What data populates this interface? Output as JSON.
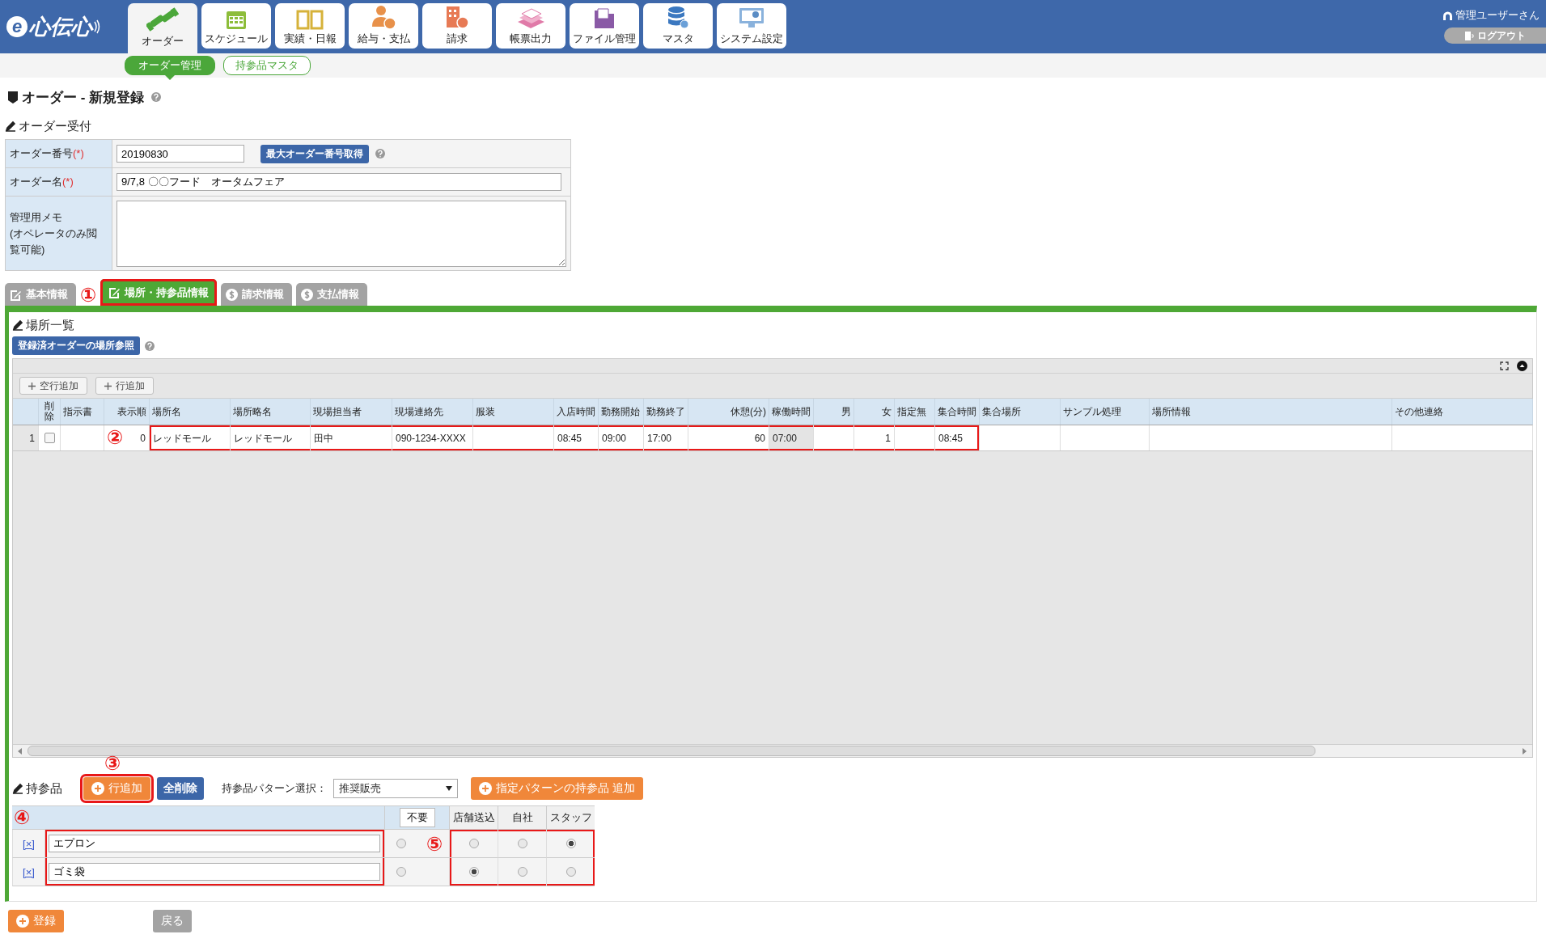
{
  "header": {
    "logo_mark": "e",
    "logo_text": "心伝心",
    "nav": [
      {
        "label": "オーダー",
        "selected": true
      },
      {
        "label": "スケジュール",
        "selected": false
      },
      {
        "label": "実績・日報",
        "selected": false
      },
      {
        "label": "給与・支払",
        "selected": false
      },
      {
        "label": "請求",
        "selected": false
      },
      {
        "label": "帳票出力",
        "selected": false
      },
      {
        "label": "ファイル管理",
        "selected": false
      },
      {
        "label": "マスタ",
        "selected": false
      },
      {
        "label": "システム設定",
        "selected": false
      }
    ],
    "user": "管理ユーザーさん",
    "logout": "ログアウト"
  },
  "subnav": [
    {
      "label": "オーダー管理",
      "selected": true
    },
    {
      "label": "持参品マスタ",
      "selected": false
    }
  ],
  "page_title": "オーダー - 新規登録",
  "reception": {
    "heading": "オーダー受付",
    "fields": [
      {
        "kind": "text",
        "label": "オーダー番号",
        "required": "(*)",
        "value": "20190830",
        "button": "最大オーダー番号取得"
      },
      {
        "kind": "wide",
        "label": "オーダー名",
        "required": "(*)",
        "value": "9/7,8 〇〇フード　オータムフェア"
      },
      {
        "kind": "textarea",
        "label": "管理用メモ",
        "note": "(オペレータのみ閲覧可能)"
      }
    ]
  },
  "tabs": [
    {
      "label": "基本情報",
      "selected": false,
      "highlighted": false
    },
    {
      "label": "場所・持参品情報",
      "selected": true,
      "highlighted": true,
      "callout": "①"
    },
    {
      "label": "請求情報",
      "selected": false,
      "highlighted": false
    },
    {
      "label": "支払情報",
      "selected": false,
      "highlighted": false
    }
  ],
  "places": {
    "heading": "場所一覧",
    "ref_button": "登録済オーダーの場所参照",
    "toolbar_buttons": [
      "空行追加",
      "行追加"
    ],
    "columns": [
      {
        "kind": "row_number"
      },
      {
        "kind": "header",
        "label": "削除"
      },
      {
        "kind": "header",
        "label": "指示書"
      },
      {
        "kind": "header",
        "label": "表示順"
      },
      {
        "kind": "header",
        "label": "場所名"
      },
      {
        "kind": "header",
        "label": "場所略名"
      },
      {
        "kind": "header",
        "label": "現場担当者"
      },
      {
        "kind": "header",
        "label": "現場連絡先"
      },
      {
        "kind": "header",
        "label": "服装"
      },
      {
        "kind": "header",
        "label": "入店時間"
      },
      {
        "kind": "header",
        "label": "勤務開始"
      },
      {
        "kind": "header",
        "label": "勤務終了"
      },
      {
        "kind": "header",
        "label": "休憩(分)"
      },
      {
        "kind": "header",
        "label": "稼働時間"
      },
      {
        "kind": "header",
        "label": "男"
      },
      {
        "kind": "header",
        "label": "女"
      },
      {
        "kind": "header",
        "label": "指定無"
      },
      {
        "kind": "header",
        "label": "集合時間"
      },
      {
        "kind": "header",
        "label": "集合場所"
      },
      {
        "kind": "header",
        "label": "サンプル処理"
      },
      {
        "kind": "header",
        "label": "場所情報"
      },
      {
        "kind": "header",
        "label": "その他連絡"
      }
    ],
    "rows": [
      {
        "callout": "②",
        "cells": [
          {
            "kind": "number",
            "text": "1"
          },
          {
            "kind": "checkbox",
            "checked": false
          },
          {
            "kind": "text",
            "highlighted": false,
            "readonly": false
          },
          {
            "kind": "text",
            "text": "0",
            "highlighted": false,
            "readonly": false
          },
          {
            "kind": "text",
            "text": "レッドモール",
            "highlighted": true,
            "readonly": false
          },
          {
            "kind": "text",
            "text": "レッドモール",
            "highlighted": true,
            "readonly": false
          },
          {
            "kind": "text",
            "text": "田中",
            "highlighted": true,
            "readonly": false
          },
          {
            "kind": "text",
            "text": "090-1234-XXXX",
            "highlighted": true,
            "readonly": false
          },
          {
            "kind": "text",
            "highlighted": true,
            "readonly": false
          },
          {
            "kind": "text",
            "text": "08:45",
            "highlighted": true,
            "readonly": false
          },
          {
            "kind": "text",
            "text": "09:00",
            "highlighted": true,
            "readonly": false
          },
          {
            "kind": "text",
            "text": "17:00",
            "highlighted": true,
            "readonly": false
          },
          {
            "kind": "text",
            "text": "60",
            "highlighted": true,
            "readonly": false
          },
          {
            "kind": "text",
            "text": "07:00",
            "highlighted": true,
            "readonly": true
          },
          {
            "kind": "text",
            "highlighted": true,
            "readonly": false
          },
          {
            "kind": "text",
            "text": "1",
            "highlighted": true,
            "readonly": false
          },
          {
            "kind": "text",
            "highlighted": true,
            "readonly": false
          },
          {
            "kind": "text",
            "text": "08:45",
            "highlighted": true,
            "readonly": false
          },
          {
            "kind": "text",
            "highlighted": false,
            "readonly": false
          },
          {
            "kind": "text",
            "highlighted": false,
            "readonly": false
          },
          {
            "kind": "text",
            "highlighted": false,
            "readonly": false
          },
          {
            "kind": "text",
            "highlighted": false,
            "readonly": false
          }
        ]
      }
    ]
  },
  "items": {
    "heading": "持参品",
    "add_button": "行追加",
    "add_highlighted": true,
    "add_callout": "③",
    "clear_button": "全削除",
    "pattern_label": "持参品パターン選択：",
    "pattern_value": "推奨販売",
    "pattern_add_button": "指定パターンの持参品 追加",
    "name_callout": "④",
    "option_callout": "⑤",
    "option_columns": [
      {
        "label": "不要",
        "kind": "boxed"
      },
      {
        "label": "店舗送込",
        "kind": "plain"
      },
      {
        "label": "自社",
        "kind": "plain"
      },
      {
        "label": "スタッフ",
        "kind": "plain"
      }
    ],
    "rows": [
      {
        "delete": "[×]",
        "name": "エプロン",
        "name_highlighted": true,
        "options": [
          {
            "selected": false,
            "highlighted": false
          },
          {
            "selected": false,
            "highlighted": true
          },
          {
            "selected": false,
            "highlighted": true
          },
          {
            "selected": true,
            "highlighted": true
          }
        ]
      },
      {
        "delete": "[×]",
        "name": "ゴミ袋",
        "name_highlighted": true,
        "options": [
          {
            "selected": false,
            "highlighted": false
          },
          {
            "selected": true,
            "highlighted": true
          },
          {
            "selected": false,
            "highlighted": true
          },
          {
            "selected": false,
            "highlighted": true
          }
        ]
      }
    ]
  },
  "footer": {
    "register": "登録",
    "back": "戻る"
  }
}
